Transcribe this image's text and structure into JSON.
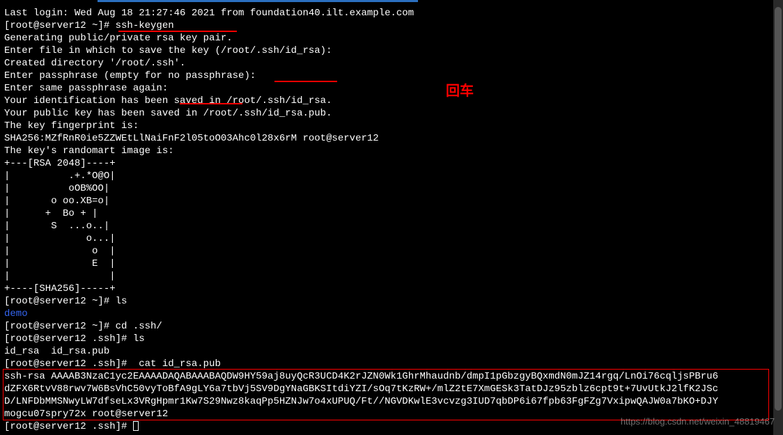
{
  "annotation": {
    "enter_key": "回车",
    "watermark": "https://blog.csdn.net/weixin_48819467"
  },
  "terminal": {
    "lines": [
      {
        "text": "Last login: Wed Aug 18 21:27:46 2021 from foundation40.ilt.example.com",
        "color": "white"
      },
      {
        "text": "[root@server12 ~]# ssh-keygen",
        "color": "white"
      },
      {
        "text": "Generating public/private rsa key pair.",
        "color": "white"
      },
      {
        "text": "Enter file in which to save the key (/root/.ssh/id_rsa):",
        "color": "white"
      },
      {
        "text": "Created directory '/root/.ssh'.",
        "color": "white"
      },
      {
        "text": "Enter passphrase (empty for no passphrase):",
        "color": "white"
      },
      {
        "text": "Enter same passphrase again:",
        "color": "white"
      },
      {
        "text": "Your identification has been saved in /root/.ssh/id_rsa.",
        "color": "white"
      },
      {
        "text": "Your public key has been saved in /root/.ssh/id_rsa.pub.",
        "color": "white"
      },
      {
        "text": "The key fingerprint is:",
        "color": "white"
      },
      {
        "text": "SHA256:MZfRnR0ie5ZZWEtLlNaiFnF2l05toO03Ahc0l28x6rM root@server12",
        "color": "white"
      },
      {
        "text": "The key's randomart image is:",
        "color": "white"
      },
      {
        "text": "+---[RSA 2048]----+",
        "color": "white"
      },
      {
        "text": "|          .+.*O@O|",
        "color": "white"
      },
      {
        "text": "|          oOB%OO|",
        "color": "white"
      },
      {
        "text": "|       o oo.XB=o|",
        "color": "white"
      },
      {
        "text": "|      +  Bo + |",
        "color": "white"
      },
      {
        "text": "|       S  ...o..|",
        "color": "white"
      },
      {
        "text": "|             o...|",
        "color": "white"
      },
      {
        "text": "|              o  |",
        "color": "white"
      },
      {
        "text": "|              E  |",
        "color": "white"
      },
      {
        "text": "|                 |",
        "color": "white"
      },
      {
        "text": "+----[SHA256]-----+",
        "color": "white"
      },
      {
        "text": "[root@server12 ~]# ls",
        "color": "white"
      },
      {
        "text": "demo",
        "color": "blue"
      },
      {
        "text": "[root@server12 ~]# cd .ssh/",
        "color": "white"
      },
      {
        "text": "[root@server12 .ssh]# ls",
        "color": "white"
      },
      {
        "text": "id_rsa  id_rsa.pub",
        "color": "white"
      },
      {
        "text": "[root@server12 .ssh]#  cat id_rsa.pub",
        "color": "white"
      },
      {
        "text": "ssh-rsa AAAAB3NzaC1yc2EAAAADAQABAAABAQDW9HY59aj8uyQcR3UCD4K2rJZN0Wk1GhrMhaudnb/dmpI1pGbzgyBQxmdN0mJZ14rgq/LnOi76cqljsPBru6",
        "color": "white"
      },
      {
        "text": "dZFX6RtvV88rwv7W6BsVhC50vyToBfA9gLY6a7tbVj5SV9DgYNaGBKSItdiYZI/sOq7tKzRW+/mlZ2tE7XmGESk3TatDJz95zblz6cpt9t+7UvUtkJ2lfK2JSc",
        "color": "white"
      },
      {
        "text": "D/LNFDbMMSNwyLW7dfseLx3VRgHpmr1Kw7S29Nwz8kaqPp5HZNJw7o4xUPUQ/Ft//NGVDKwlE3vcvzg3IUD7qbDP6i67fpb63FgFZg7VxipwQAJW0a7bKO+DJY",
        "color": "white"
      },
      {
        "text": "mogcu07spry72x root@server12",
        "color": "white"
      },
      {
        "text": "[root@server12 .ssh]# ",
        "color": "white",
        "cursor": true
      }
    ]
  }
}
